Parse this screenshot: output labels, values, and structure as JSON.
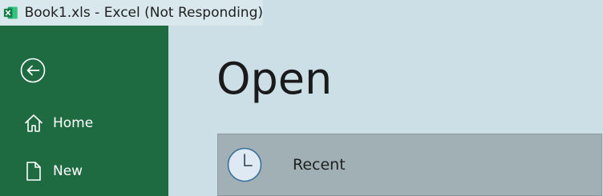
{
  "window": {
    "title": "Book1.xls - Excel (Not Responding)",
    "app_icon": "excel-icon"
  },
  "sidebar": {
    "background": "#1e6b41",
    "back_icon": "back-arrow-icon",
    "items": [
      {
        "label": "Home",
        "icon": "home-icon"
      },
      {
        "label": "New",
        "icon": "new-document-icon"
      }
    ]
  },
  "main": {
    "title": "Open",
    "locations": [
      {
        "label": "Recent",
        "icon": "clock-icon",
        "selected": true
      }
    ]
  },
  "colors": {
    "excel_green": "#1e6b41",
    "selected_row": "#a1b0b5",
    "background": "#ccdfe6"
  }
}
